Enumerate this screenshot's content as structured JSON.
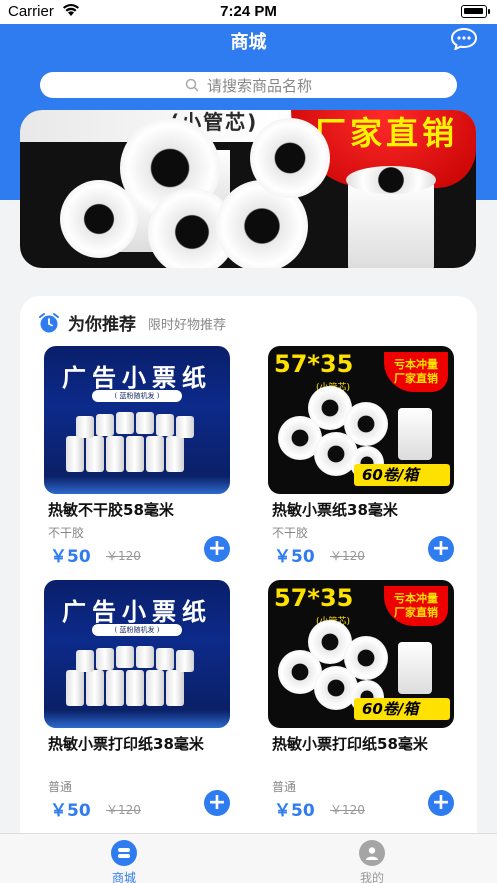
{
  "status_bar": {
    "carrier": "Carrier",
    "time": "7:24 PM"
  },
  "header": {
    "title": "商城"
  },
  "search": {
    "placeholder": "请搜索商品名称"
  },
  "banner": {
    "tagline": "(小管芯)",
    "tagline2": "厂家直销"
  },
  "section": {
    "title": "为你推荐",
    "subtitle": "限时好物推荐"
  },
  "ads": {
    "a_title": "广告小票纸",
    "a_pill": "( 蓝粉随机发 )",
    "b_number": "57*35",
    "b_sub": "(小管芯)",
    "b_badge_line1": "亏本冲量",
    "b_badge_line2": "厂家直销",
    "b_count": "60卷/箱"
  },
  "products": [
    {
      "name": "热敏不干胶58毫米",
      "tag": "不干胶",
      "price": "￥50",
      "old_price": "￥120"
    },
    {
      "name": "热敏小票纸38毫米",
      "tag": "不干胶",
      "price": "￥50",
      "old_price": "￥120"
    },
    {
      "name": "热敏小票打印纸38毫米",
      "tag": "普通",
      "price": "￥50",
      "old_price": "￥120"
    },
    {
      "name": "热敏小票打印纸58毫米",
      "tag": "普通",
      "price": "￥50",
      "old_price": "￥120"
    }
  ],
  "add_label": "+",
  "tabbar": {
    "home": "商城",
    "mine": "我的"
  },
  "colors": {
    "accent": "#2f7bf0"
  }
}
